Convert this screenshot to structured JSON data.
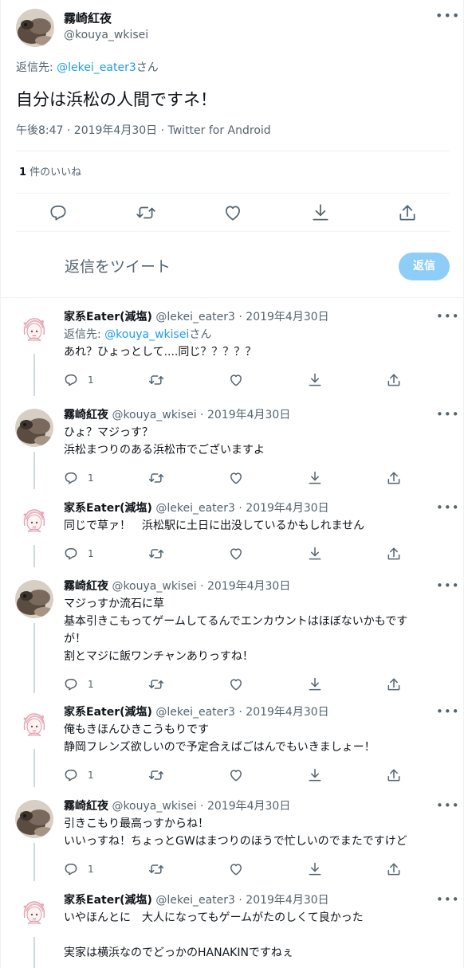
{
  "main_tweet": {
    "author_name": "霧崎紅夜",
    "author_handle": "@kouya_wkisei",
    "reply_to_prefix": "返信先: ",
    "reply_to_handle": "@lekei_eater3",
    "reply_to_suffix": "さん",
    "text": "自分は浜松の人間ですネ！",
    "meta": "午後8:47 · 2019年4月30日 · Twitter for Android",
    "likes_count": "1",
    "likes_label": " 件のいいね",
    "more": "•••"
  },
  "compose": {
    "placeholder": "返信をツイート",
    "reply_button": "返信"
  },
  "replies": [
    {
      "name": "家系Eater(減塩)",
      "handle": "@lekei_eater3",
      "dot": " · ",
      "date": "2019年4月30日",
      "reply_to_prefix": "返信先: ",
      "reply_to_handle": "@kouya_wkisei",
      "reply_to_suffix": "さん",
      "lines": [
        "あれ？ひょっとして....同じ？？？？？"
      ],
      "reply_count": "1"
    },
    {
      "name": "霧崎紅夜",
      "handle": "@kouya_wkisei",
      "dot": " · ",
      "date": "2019年4月30日",
      "lines": [
        "ひょ？マジっす？",
        "浜松まつりのある浜松市でございますよ"
      ],
      "reply_count": "1"
    },
    {
      "name": "家系Eater(減塩)",
      "handle": "@lekei_eater3",
      "dot": " · ",
      "date": "2019年4月30日",
      "lines": [
        "同じで草ァ！　浜松駅に土日に出没しているかもしれません"
      ],
      "reply_count": "1"
    },
    {
      "name": "霧崎紅夜",
      "handle": "@kouya_wkisei",
      "dot": " · ",
      "date": "2019年4月30日",
      "lines": [
        "マジっすか流石に草",
        "基本引きこもってゲームしてるんでエンカウントはほぼないかもです",
        "が！",
        "割とマジに飯ワンチャンありっすね！"
      ],
      "reply_count": "1"
    },
    {
      "name": "家系Eater(減塩)",
      "handle": "@lekei_eater3",
      "dot": " · ",
      "date": "2019年4月30日",
      "lines": [
        "俺もきほんひきこうもりです",
        "静岡フレンズ欲しいので予定合えばごはんでもいきましょー！"
      ],
      "reply_count": "1"
    },
    {
      "name": "霧崎紅夜",
      "handle": "@kouya_wkisei",
      "dot": " · ",
      "date": "2019年4月30日",
      "lines": [
        "引きこもり最高っすからね！",
        "いいっすね！ちょっとGWはまつりのほうで忙しいのでまたですけど"
      ],
      "reply_count": "1"
    },
    {
      "name": "家系Eater(減塩)",
      "handle": "@lekei_eater3",
      "dot": " · ",
      "date": "2019年4月30日",
      "lines": [
        "いやほんとに　大人になってもゲームがたのしくて良かった",
        "",
        "実家は横浜なのでどっかのHANAKINですねぇ"
      ],
      "reply_count": ""
    }
  ],
  "icons": {
    "reply": "reply-icon",
    "retweet": "retweet-icon",
    "like": "heart-icon",
    "bookmark": "bookmark-icon",
    "share": "share-icon",
    "more": "more-icon"
  },
  "colors": {
    "accent": "#1d9bf0",
    "reply_button_disabled": "#8ecdf8",
    "secondary_text": "#536471",
    "divider": "#eff3f4",
    "thread_line": "#cfd9de"
  }
}
